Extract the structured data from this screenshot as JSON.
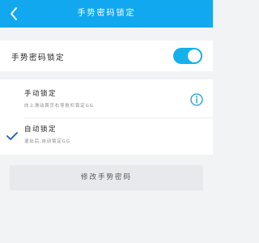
{
  "header": {
    "title": "手势密码锁定",
    "background": "#12a8f0"
  },
  "toggle_row": {
    "label": "手势密码锁定",
    "enabled": true,
    "accent": "#14b1ea"
  },
  "options": [
    {
      "title": "手动锁定",
      "desc": "向上滑动首页右导航栏锁定GG",
      "selected": false,
      "icon": "info-icon"
    },
    {
      "title": "自动锁定",
      "desc": "退出后,自动锁定GG",
      "selected": true,
      "icon": "check-icon"
    }
  ],
  "modify_button": {
    "label": "修改手势密码"
  }
}
